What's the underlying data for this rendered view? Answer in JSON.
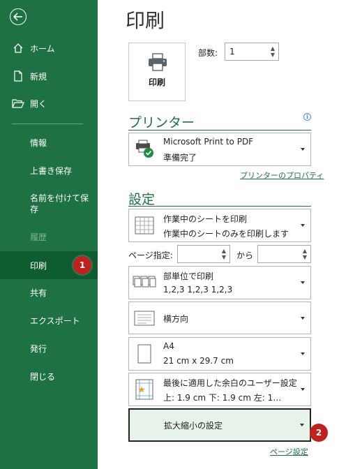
{
  "sidebar": {
    "back_icon": "back-arrow-icon",
    "items": [
      {
        "label": "ホーム",
        "icon": "home-icon"
      },
      {
        "label": "新規",
        "icon": "new-document-icon"
      },
      {
        "label": "開く",
        "icon": "open-folder-icon"
      },
      {
        "label": "情報"
      },
      {
        "label": "上書き保存"
      },
      {
        "label": "名前を付けて保存"
      },
      {
        "label": "履歴",
        "disabled": true
      },
      {
        "label": "印刷",
        "active": true
      },
      {
        "label": "共有"
      },
      {
        "label": "エクスポート"
      },
      {
        "label": "発行"
      },
      {
        "label": "閉じる"
      }
    ]
  },
  "badges": [
    "1",
    "2"
  ],
  "main": {
    "title": "印刷",
    "print_button_label": "印刷",
    "copies_label": "部数:",
    "copies_value": "1",
    "printer_section_title": "プリンター",
    "printer": {
      "name": "Microsoft Print to PDF",
      "status": "準備完了"
    },
    "printer_properties_link": "プリンターのプロパティ",
    "settings_section_title": "設定",
    "print_what": {
      "line1": "作業中のシートを印刷",
      "line2": "作業中のシートのみを印刷します"
    },
    "pages_label": "ページ指定:",
    "pages_from_value": "",
    "pages_to_label": "から",
    "pages_to_value": "",
    "collation": {
      "line1": "部単位で印刷",
      "line2": "1,2,3    1,2,3    1,2,3"
    },
    "orientation": {
      "line1": "横方向"
    },
    "paper_size": {
      "line1": "A4",
      "line2": "21 cm x 29.7 cm"
    },
    "margins": {
      "line1": "最後に適用した余白のユーザー設定",
      "line2": "上: 1.9 cm 下: 1.9 cm 左: 1…"
    },
    "scaling": {
      "line1": "拡大縮小の設定"
    },
    "page_setup_link": "ページ設定"
  },
  "colors": {
    "sidebar_bg": "#1e7145",
    "sidebar_active": "#0f5c33",
    "accent": "#1e7145",
    "badge": "#c0211e",
    "highlight": "#e6f2ea"
  }
}
